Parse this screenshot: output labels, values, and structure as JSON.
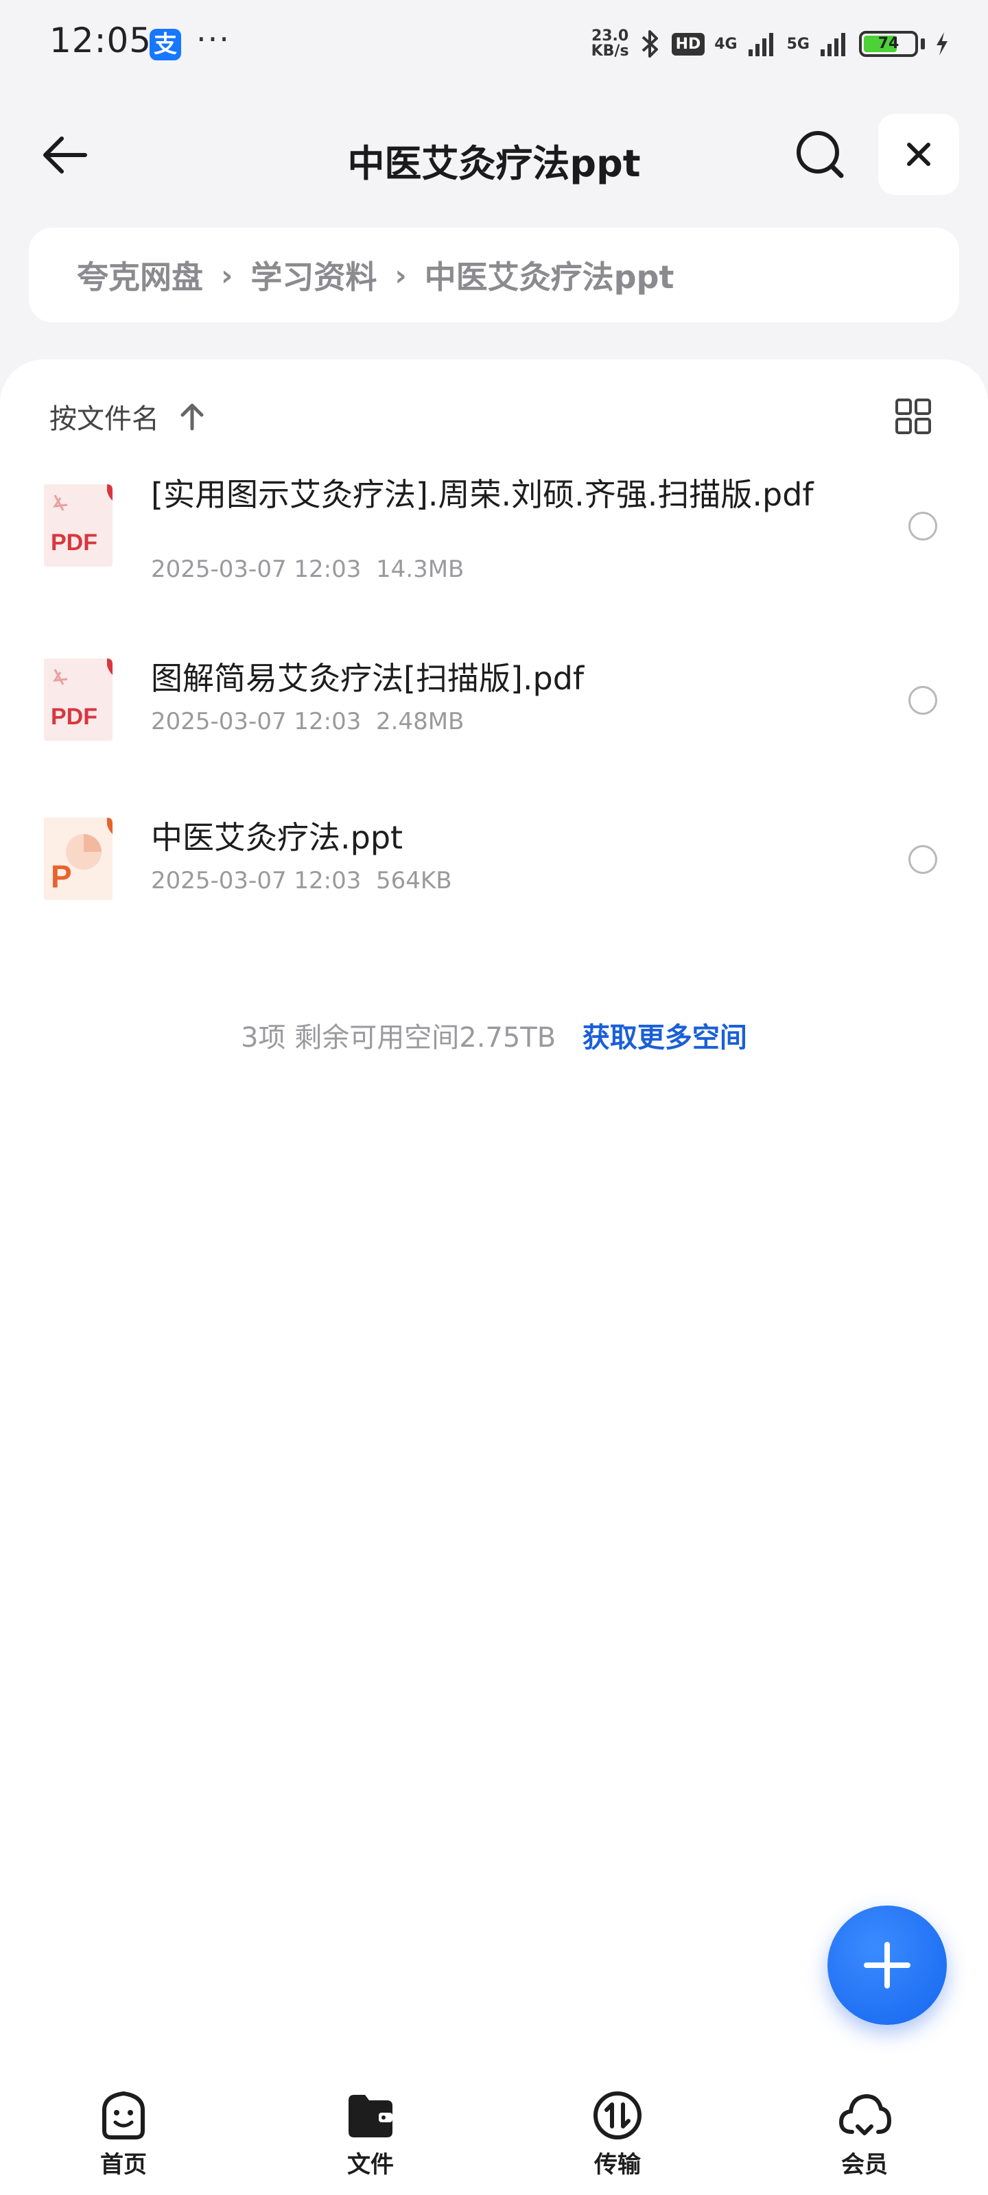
{
  "status_bar": {
    "time": "12:05",
    "alipay_glyph": "支",
    "more": "···",
    "net_speed_value": "23.0",
    "net_speed_unit": "KB/s",
    "hd_badge": "HD",
    "network_1": "4G",
    "network_2": "5G",
    "battery": "74"
  },
  "header": {
    "title": "中医艾灸疗法ppt"
  },
  "breadcrumb": {
    "items": [
      "夸克网盘",
      "学习资料",
      "中医艾灸疗法ppt"
    ],
    "separator": "›"
  },
  "sort_bar": {
    "label": "按文件名"
  },
  "files": [
    {
      "name": "[实用图示艾灸疗法].周荣.刘硕.齐强.扫描版.pdf",
      "date": "2025-03-07 12:03",
      "size": "14.3MB",
      "type": "pdf",
      "type_label": "PDF"
    },
    {
      "name": "图解简易艾灸疗法[扫描版].pdf",
      "date": "2025-03-07 12:03",
      "size": "2.48MB",
      "type": "pdf",
      "type_label": "PDF"
    },
    {
      "name": "中医艾灸疗法.ppt",
      "date": "2025-03-07 12:03",
      "size": "564KB",
      "type": "ppt",
      "type_label": "P"
    }
  ],
  "footer": {
    "summary": "3项  剩余可用空间2.75TB",
    "link": "获取更多空间"
  },
  "bottom_nav": {
    "items": [
      {
        "label": "首页",
        "icon": "home-smile-icon"
      },
      {
        "label": "文件",
        "icon": "folder-icon"
      },
      {
        "label": "传输",
        "icon": "transfer-icon"
      },
      {
        "label": "会员",
        "icon": "cloud-icon"
      }
    ]
  },
  "colors": {
    "accent": "#1a5fd8",
    "fab": "#1566ef",
    "pdf_red": "#d9363e",
    "ppt_orange": "#e8622c"
  }
}
